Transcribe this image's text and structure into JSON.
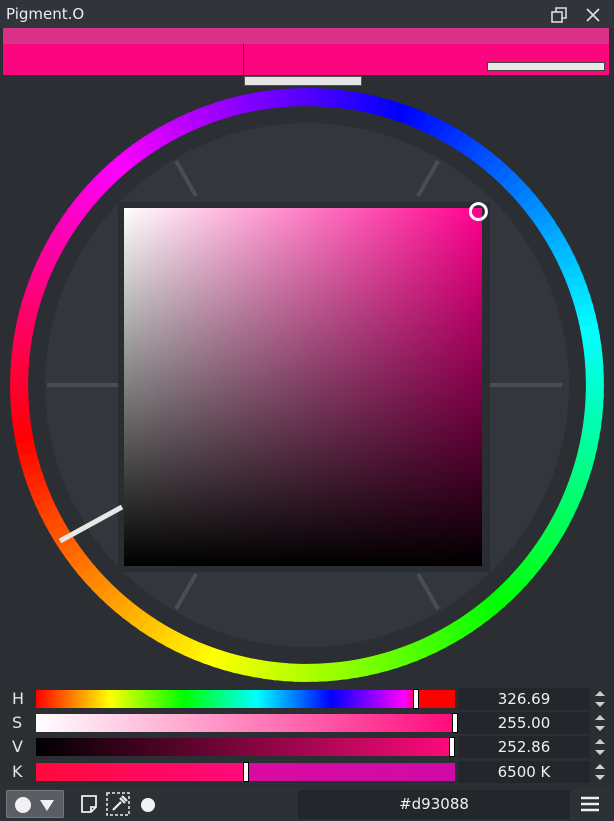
{
  "window": {
    "title": "Pigment.O"
  },
  "icons": {
    "float": "float-window-icon",
    "close": "close-icon",
    "mode": "circle-mode-icon",
    "dropdown": "caret-down-icon",
    "note": "note-icon",
    "picker": "eyedropper-icon",
    "dot": "dot-icon",
    "menu": "hamburger-menu-icon"
  },
  "colors": {
    "current": "#fc067f",
    "previous": "#d93088",
    "accent": "#ff0a7c"
  },
  "hue": 326.69,
  "saturation_fraction": 0.99,
  "value_fraction": 0.99,
  "sliders": [
    {
      "label": "H",
      "value": "326.69",
      "fraction": 0.908
    },
    {
      "label": "S",
      "value": "255.00",
      "fraction": 1.0
    },
    {
      "label": "V",
      "value": "252.86",
      "fraction": 0.992
    },
    {
      "label": "K",
      "value": "6500 K",
      "fraction": 0.5
    }
  ],
  "hex": "#d93088"
}
